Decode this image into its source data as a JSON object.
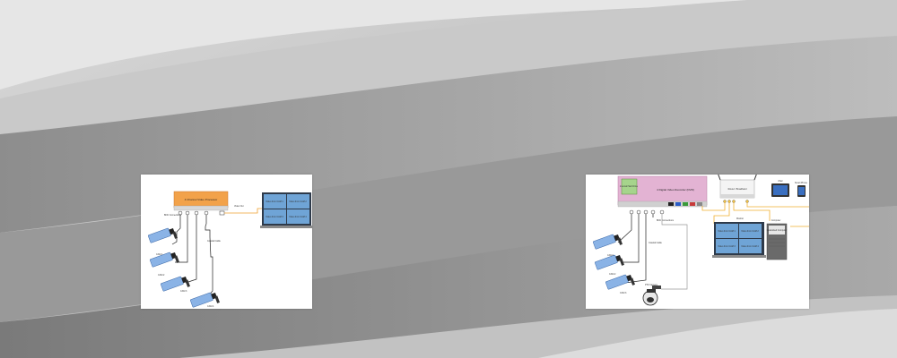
{
  "left_diagram": {
    "processor_label": "4 Channel Video Processor",
    "port_labels": [
      "1",
      "2",
      "3",
      "4"
    ],
    "bnc_label": "BNC Connections",
    "video_out_label": "Video Out",
    "monitor_cells": [
      "Video from CAM 1",
      "Video from CAM 2",
      "Video from CAM 3",
      "Video from CAM 4"
    ],
    "camera_labels": [
      "CAM 1",
      "CAM 2",
      "CAM 3",
      "CAM 4"
    ],
    "coax_label": "Coaxial Cable"
  },
  "right_diagram": {
    "dvr_label": "4 Digital Video Recorder (DVR)",
    "hdd_label": "Internal Hard Drive",
    "port_labels": [
      "1",
      "2",
      "3",
      "4"
    ],
    "bnc_label": "BNC Connections",
    "coax_label": "Coaxial Cable",
    "router_label": "Router / Broadband",
    "monitor_label": "Monitor",
    "monitor_cells": [
      "Video from CAM 1",
      "Video from CAM 2",
      "Video from CAM 3",
      "Video from CAM 4"
    ],
    "computer_label": "Computer",
    "computer_text": "Networked Computer",
    "tablet_label": "iPad",
    "phone_label": "Smart Phone",
    "ptz_label": "PTZ Camera",
    "camera_labels": [
      "CAM 1",
      "CAM 2",
      "CAM 3"
    ]
  }
}
